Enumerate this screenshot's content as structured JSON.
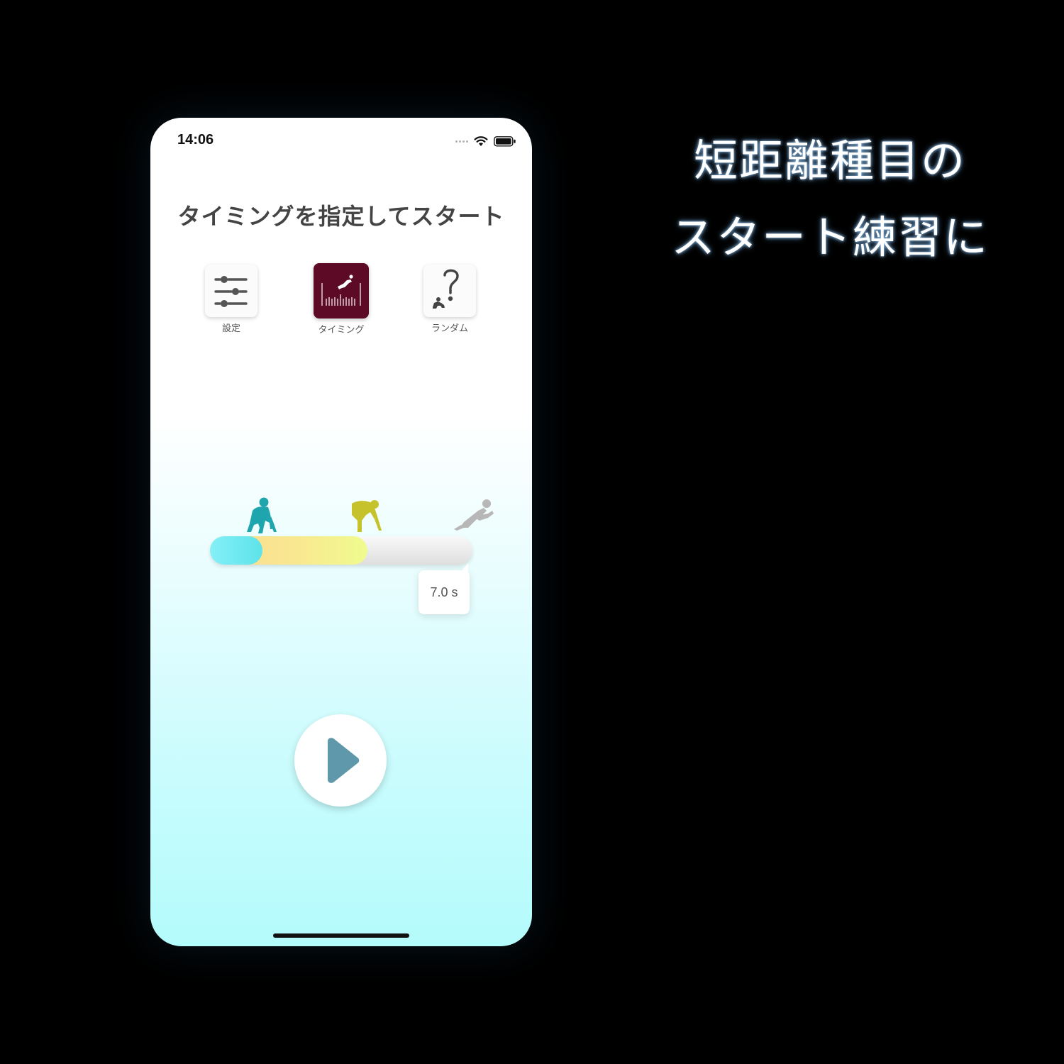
{
  "status_bar": {
    "time": "14:06"
  },
  "page_title": "タイミングを指定してスタート",
  "modes": [
    {
      "label": "設定",
      "icon": "sliders-icon",
      "active": false
    },
    {
      "label": "タイミング",
      "icon": "timing-runner-icon",
      "active": true
    },
    {
      "label": "ランダム",
      "icon": "random-question-icon",
      "active": false
    }
  ],
  "start_phases": [
    {
      "icon": "on-your-marks-runner-icon",
      "color": "#1ea5ad"
    },
    {
      "icon": "set-runner-icon",
      "color": "#c6c22c"
    },
    {
      "icon": "go-runner-icon",
      "color": "#b7b7b7"
    }
  ],
  "timing_slider": {
    "value_label": "7.0 s",
    "segment1_fraction": 0.2,
    "segment2_fraction": 0.6
  },
  "colors": {
    "active_mode": "#5c0a26",
    "play_icon": "#5f97ab",
    "segment1": "#5ee2ea",
    "segment2": "#f2ef90"
  },
  "caption": {
    "line1": "短距離種目の",
    "line2": "スタート練習に"
  }
}
